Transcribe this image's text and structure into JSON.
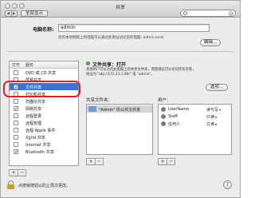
{
  "window": {
    "title": "共享"
  },
  "toolbar": {
    "back": "◀",
    "forward": "▶",
    "show_all": "全部显示",
    "search_clear": "x"
  },
  "computer_name": {
    "label": "电脑名称:",
    "value": "admin",
    "hint": "您的本地网络上的电脑可以通过此地址访问您的电脑: admin.local",
    "edit_button": "编辑..."
  },
  "services": {
    "col_on": "打开",
    "col_service": "服务",
    "items": [
      {
        "label": "DVD 或 CD 共享",
        "checked": false
      },
      {
        "label": "屏幕共享",
        "checked": false
      },
      {
        "label": "文件共享",
        "checked": true,
        "selected": true
      },
      {
        "label": "打印机共享",
        "checked": false
      },
      {
        "label": "扫描仪共享",
        "checked": false
      },
      {
        "label": "网络共享",
        "checked": true
      },
      {
        "label": "远程登录",
        "checked": false
      },
      {
        "label": "远程管理",
        "checked": false
      },
      {
        "label": "远程 Apple 事件",
        "checked": false
      },
      {
        "label": "Xgrid 共享",
        "checked": false
      },
      {
        "label": "Internet 共享",
        "checked": false
      },
      {
        "label": "Bluetooth 共享",
        "checked": true
      }
    ]
  },
  "file_sharing": {
    "status": "文件共享：打开",
    "desc_line1": "其他用户可以访问此电脑上的共享文件夹，而管理员可以访问所有宗卷，",
    "desc_line2": "地址为 \"afp://172.23.2.89/\" 或 \"admin\"。",
    "options_button": "选项..."
  },
  "shared_folders": {
    "label": "共享文件夹：",
    "items": [
      {
        "name": "\"Admin\" 的公共文件夹"
      }
    ]
  },
  "users": {
    "label": "用户：",
    "items": [
      {
        "name": "UserName",
        "perm": "读与写"
      },
      {
        "name": "Staff",
        "perm": "只读"
      },
      {
        "name": "任何人",
        "perm": "只读"
      }
    ]
  },
  "bottom": {
    "lock_text": "点按锁按钮以防止再次更改。",
    "help": "?"
  },
  "buttons": {
    "plus": "+",
    "minus": "−"
  },
  "colors": {
    "selection": "#3875d7",
    "highlight_ring": "#d8202a",
    "status_on": "#3cbc3c"
  }
}
